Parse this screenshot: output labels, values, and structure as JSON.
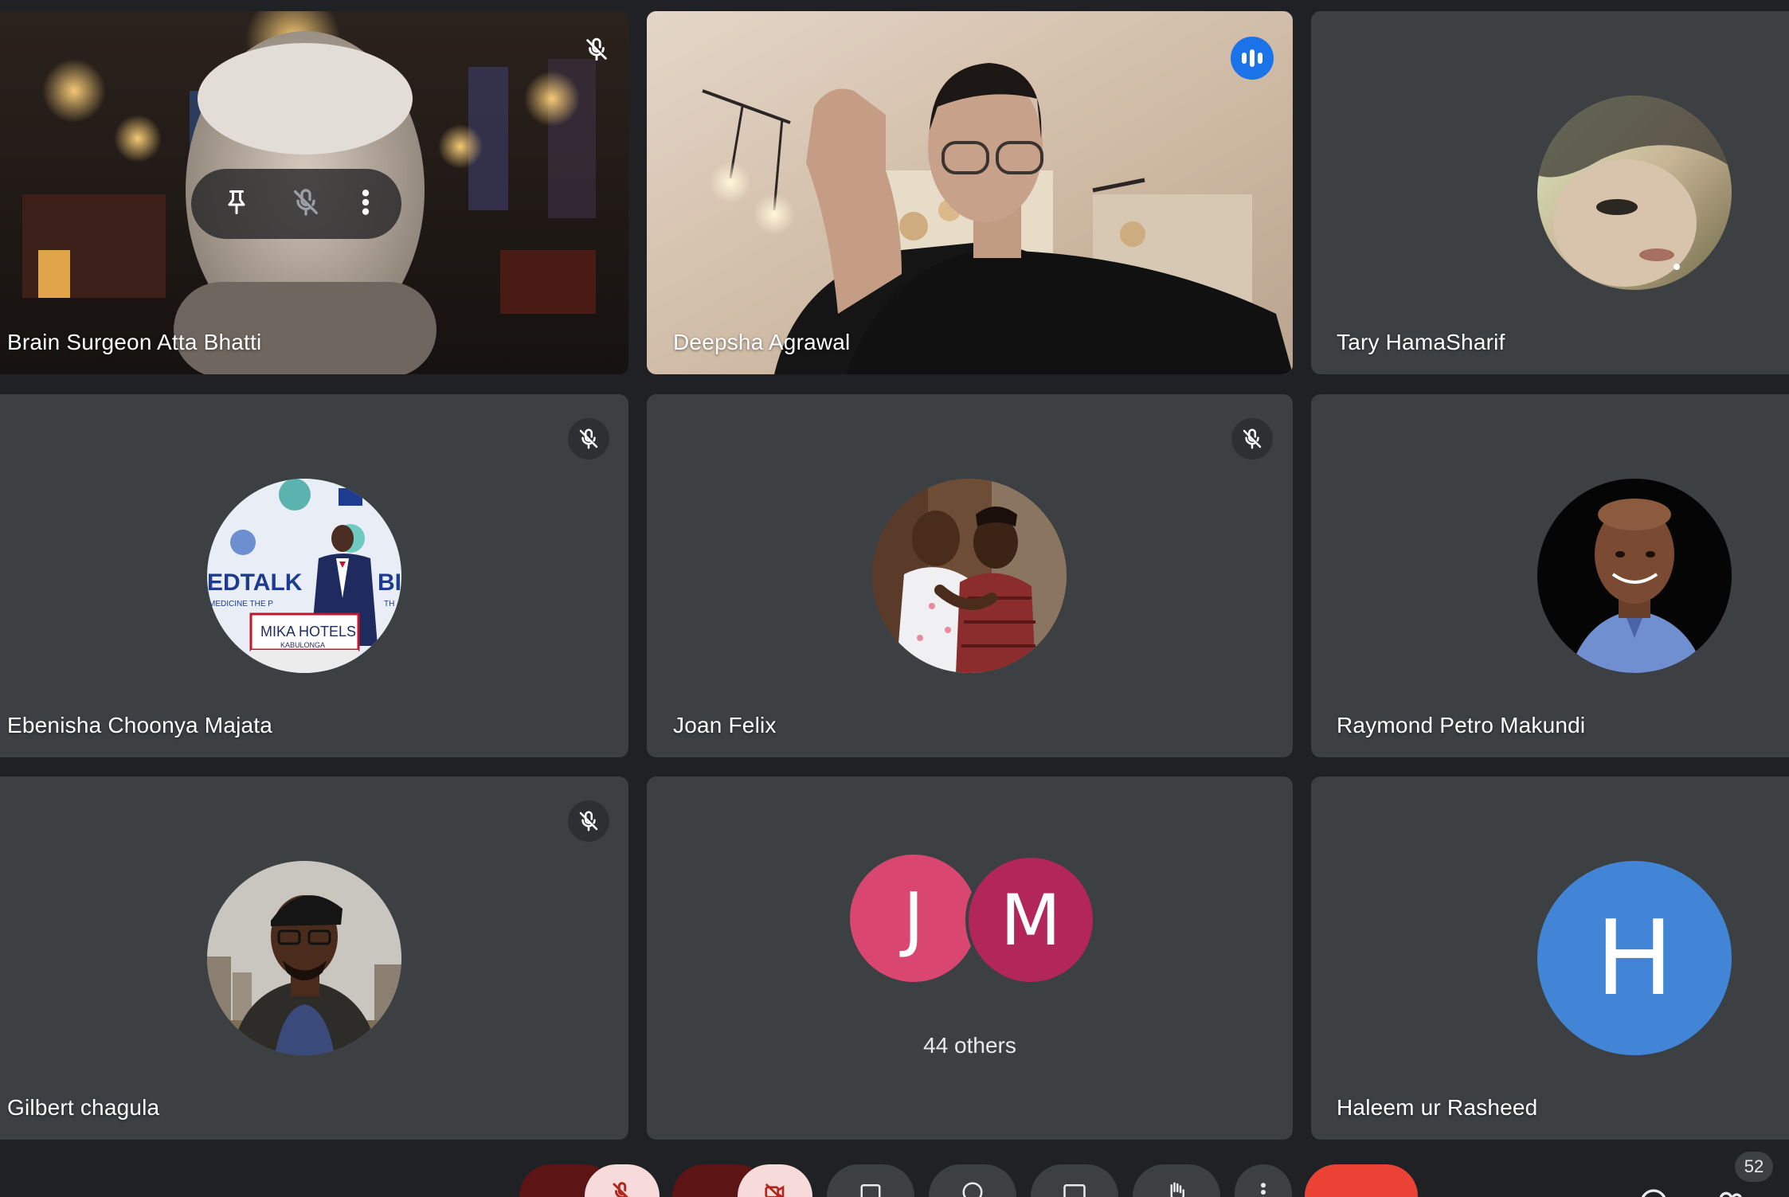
{
  "participants": [
    {
      "name": "Brain Surgeon Atta Bhatti",
      "muted": true,
      "video": true
    },
    {
      "name": "Deepsha Agrawal",
      "muted": false,
      "speaking": true,
      "video": true
    },
    {
      "name": "Tary HamaSharif",
      "muted": false,
      "video": false
    },
    {
      "name": "Ebenisha Choonya Majata",
      "muted": true,
      "video": false
    },
    {
      "name": "Joan Felix",
      "muted": true,
      "video": false
    },
    {
      "name": "Raymond Petro Makundi",
      "muted": false,
      "video": false
    },
    {
      "name": "Gilbert chagula",
      "muted": true,
      "video": false
    },
    {
      "name": "Haleem ur Rasheed",
      "muted": false,
      "video": false,
      "initial": "H",
      "color": "#4285d6"
    }
  ],
  "others_tile": {
    "label": "44 others",
    "avatars": [
      {
        "initial": "J",
        "color": "#d9466f"
      },
      {
        "initial": "M",
        "color": "#b3265a"
      }
    ]
  },
  "avatar_art": {
    "ebenisha_banner_big": "EDTALK",
    "ebenisha_banner_big_2": "BI",
    "ebenisha_banner_small": "MEDICINE THE P",
    "ebenisha_banner_small_2": "TH",
    "ebenisha_podium": "MIKA HOTELS",
    "ebenisha_podium_sub": "KABULONGA"
  },
  "hover_controls": [
    "pin-icon",
    "mic-off-icon",
    "more-vert-icon"
  ],
  "toolbar": {
    "participant_count": "52"
  },
  "colors": {
    "speaking_border": "#8ab4f8",
    "tile_bg": "#3c4043",
    "end_call": "#ea4335"
  }
}
